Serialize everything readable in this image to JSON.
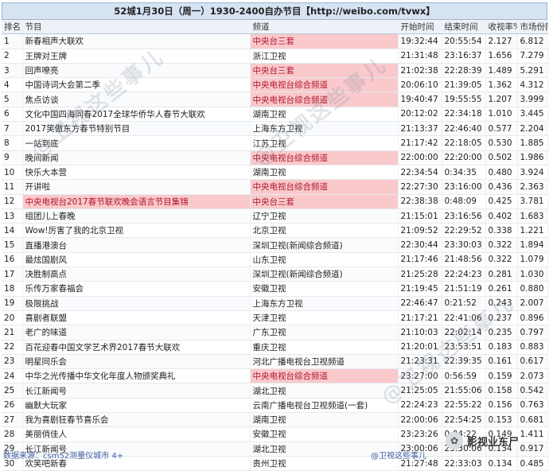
{
  "title": "52城1月30日（周一）1930-2400自办节目【http://weibo.com/tvwx】",
  "headers": [
    "排名",
    "节目",
    "频道",
    "开始时间",
    "结束时间",
    "收视率%",
    "市场份额%"
  ],
  "rows": [
    {
      "rank": "1",
      "program": "新春相声大联欢",
      "channel": "中央台三套",
      "start": "19:32:44",
      "end": "20:55:54",
      "rating": "2.127",
      "share": "6.812",
      "ch_hl": true,
      "prog_hl": false
    },
    {
      "rank": "2",
      "program": "王牌对王牌",
      "channel": "浙江卫视",
      "start": "21:31:48",
      "end": "23:16:37",
      "rating": "1.656",
      "share": "7.279",
      "ch_hl": false,
      "prog_hl": false
    },
    {
      "rank": "3",
      "program": "回声嘹亮",
      "channel": "中央台三套",
      "start": "21:02:38",
      "end": "22:28:39",
      "rating": "1.489",
      "share": "5.291",
      "ch_hl": true,
      "prog_hl": false
    },
    {
      "rank": "4",
      "program": "中国诗词大会第二季",
      "channel": "中央电视台综合频道",
      "start": "20:06:10",
      "end": "21:39:05",
      "rating": "1.362",
      "share": "4.312",
      "ch_hl": true,
      "prog_hl": false
    },
    {
      "rank": "5",
      "program": "焦点访谈",
      "channel": "中央电视台综合频道",
      "start": "19:40:47",
      "end": "19:55:55",
      "rating": "1.207",
      "share": "3.999",
      "ch_hl": true,
      "prog_hl": false
    },
    {
      "rank": "6",
      "program": "文化中国四海同春2017全球华侨华人春节大联欢",
      "channel": "湖南卫视",
      "start": "20:12:02",
      "end": "22:34:18",
      "rating": "1.010",
      "share": "3.445",
      "ch_hl": false,
      "prog_hl": false
    },
    {
      "rank": "7",
      "program": "2017笑傲东方春节特别节目",
      "channel": "上海东方卫视",
      "start": "21:13:37",
      "end": "22:46:40",
      "rating": "0.577",
      "share": "2.204",
      "ch_hl": false,
      "prog_hl": false
    },
    {
      "rank": "8",
      "program": "一站到底",
      "channel": "江苏卫视",
      "start": "21:17:42",
      "end": "22:18:05",
      "rating": "0.530",
      "share": "1.885",
      "ch_hl": false,
      "prog_hl": false
    },
    {
      "rank": "9",
      "program": "晚间新闻",
      "channel": "中央电视台综合频道",
      "start": "22:00:00",
      "end": "22:20:00",
      "rating": "0.502",
      "share": "1.986",
      "ch_hl": true,
      "prog_hl": false
    },
    {
      "rank": "10",
      "program": "快乐大本营",
      "channel": "湖南卫视",
      "start": "22:34:54",
      "end": "0:34:35",
      "rating": "0.480",
      "share": "3.924",
      "ch_hl": false,
      "prog_hl": false
    },
    {
      "rank": "11",
      "program": "开讲啦",
      "channel": "中央电视台综合频道",
      "start": "22:27:30",
      "end": "23:16:00",
      "rating": "0.436",
      "share": "2.363",
      "ch_hl": true,
      "prog_hl": false
    },
    {
      "rank": "12",
      "program": "中央电视台2017春节联欢晚会语言节目集锦",
      "channel": "中央台三套",
      "start": "22:38:38",
      "end": "0:48:09",
      "rating": "0.425",
      "share": "3.781",
      "ch_hl": true,
      "prog_hl": true
    },
    {
      "rank": "13",
      "program": "组团儿上春晚",
      "channel": "辽宁卫视",
      "start": "21:15:01",
      "end": "23:16:56",
      "rating": "0.402",
      "share": "1.683",
      "ch_hl": false,
      "prog_hl": false
    },
    {
      "rank": "14",
      "program": "Wow!厉害了我的北京卫视",
      "channel": "北京卫视",
      "start": "21:09:52",
      "end": "22:29:52",
      "rating": "0.338",
      "share": "1.221",
      "ch_hl": false,
      "prog_hl": false
    },
    {
      "rank": "15",
      "program": "直播港澳台",
      "channel": "深圳卫视(新闻综合频道)",
      "start": "22:30:44",
      "end": "23:30:03",
      "rating": "0.322",
      "share": "1.894",
      "ch_hl": false,
      "prog_hl": false
    },
    {
      "rank": "16",
      "program": "最炫国剧风",
      "channel": "山东卫视",
      "start": "21:17:46",
      "end": "21:48:56",
      "rating": "0.322",
      "share": "1.079",
      "ch_hl": false,
      "prog_hl": false
    },
    {
      "rank": "17",
      "program": "决胜制高点",
      "channel": "深圳卫视(新闻综合频道)",
      "start": "21:25:28",
      "end": "22:24:23",
      "rating": "0.281",
      "share": "1.030",
      "ch_hl": false,
      "prog_hl": false
    },
    {
      "rank": "18",
      "program": "乐传万家春福会",
      "channel": "安徽卫视",
      "start": "21:19:45",
      "end": "21:51:19",
      "rating": "0.261",
      "share": "0.880",
      "ch_hl": false,
      "prog_hl": false
    },
    {
      "rank": "19",
      "program": "极限挑战",
      "channel": "上海东方卫视",
      "start": "22:46:47",
      "end": "0:21:52",
      "rating": "0.243",
      "share": "2.007",
      "ch_hl": false,
      "prog_hl": false
    },
    {
      "rank": "20",
      "program": "喜剧者联盟",
      "channel": "天津卫视",
      "start": "21:17:21",
      "end": "22:41:06",
      "rating": "0.237",
      "share": "0.896",
      "ch_hl": false,
      "prog_hl": false
    },
    {
      "rank": "21",
      "program": "老广的味道",
      "channel": "广东卫视",
      "start": "21:10:03",
      "end": "22:02:14",
      "rating": "0.235",
      "share": "0.797",
      "ch_hl": false,
      "prog_hl": false
    },
    {
      "rank": "22",
      "program": "百花迎春中国文学艺术界2017春节大联欢",
      "channel": "重庆卫视",
      "start": "21:20:01",
      "end": "23:53:51",
      "rating": "0.183",
      "share": "0.883",
      "ch_hl": false,
      "prog_hl": false
    },
    {
      "rank": "23",
      "program": "明星同乐会",
      "channel": "河北广播电视台卫视频道",
      "start": "21:23:31",
      "end": "22:39:35",
      "rating": "0.161",
      "share": "0.617",
      "ch_hl": false,
      "prog_hl": false
    },
    {
      "rank": "24",
      "program": "中华之光传播中华文化年度人物颁奖典礼",
      "channel": "中央电视台综合频道",
      "start": "23:27:00",
      "end": "0:56:59",
      "rating": "0.159",
      "share": "2.073",
      "ch_hl": true,
      "prog_hl": false
    },
    {
      "rank": "25",
      "program": "长江新闻号",
      "channel": "湖北卫视",
      "start": "21:25:05",
      "end": "21:55:06",
      "rating": "0.158",
      "share": "0.542",
      "ch_hl": false,
      "prog_hl": false
    },
    {
      "rank": "26",
      "program": "幽默大玩家",
      "channel": "云南广播电视台卫视频道(一套)",
      "start": "22:24:23",
      "end": "22:55:22",
      "rating": "0.156",
      "share": "0.763",
      "ch_hl": false,
      "prog_hl": false
    },
    {
      "rank": "27",
      "program": "我为喜剧狂春节喜乐会",
      "channel": "湖南卫视",
      "start": "22:00:06",
      "end": "22:54:25",
      "rating": "0.153",
      "share": "0.681",
      "ch_hl": false,
      "prog_hl": false
    },
    {
      "rank": "28",
      "program": "美丽俏佳人",
      "channel": "安徽卫视",
      "start": "23:23:26",
      "end": "0:04:22",
      "rating": "0.149",
      "share": "1.411",
      "ch_hl": false,
      "prog_hl": false
    },
    {
      "rank": "29",
      "program": "长江新闻号",
      "channel": "湖北卫视",
      "start": "23:00:06",
      "end": "23:30:06",
      "rating": "0.134",
      "share": "0.917",
      "ch_hl": false,
      "prog_hl": false
    },
    {
      "rank": "30",
      "program": "欢笑吧新春",
      "channel": "贵州卫视",
      "start": "21:27:48",
      "end": "22:33:03",
      "rating": "0.134",
      "share": "0.485",
      "ch_hl": false,
      "prog_hl": false
    }
  ],
  "footer": {
    "source": "数据来源：csm52测量仪城市 4+",
    "watermark_handle": "@卫视这些事儿",
    "wechat_name": "影视业东尸"
  },
  "watermarks": [
    "@卫视这些事儿",
    "@卫视这些事儿",
    "@卫视这些事儿"
  ],
  "colors": {
    "title_bg": "#d6e3f3",
    "highlight_bg": "#f9c9cc",
    "highlight_text": "#b0142a",
    "footer_text": "#3a5fa0"
  }
}
